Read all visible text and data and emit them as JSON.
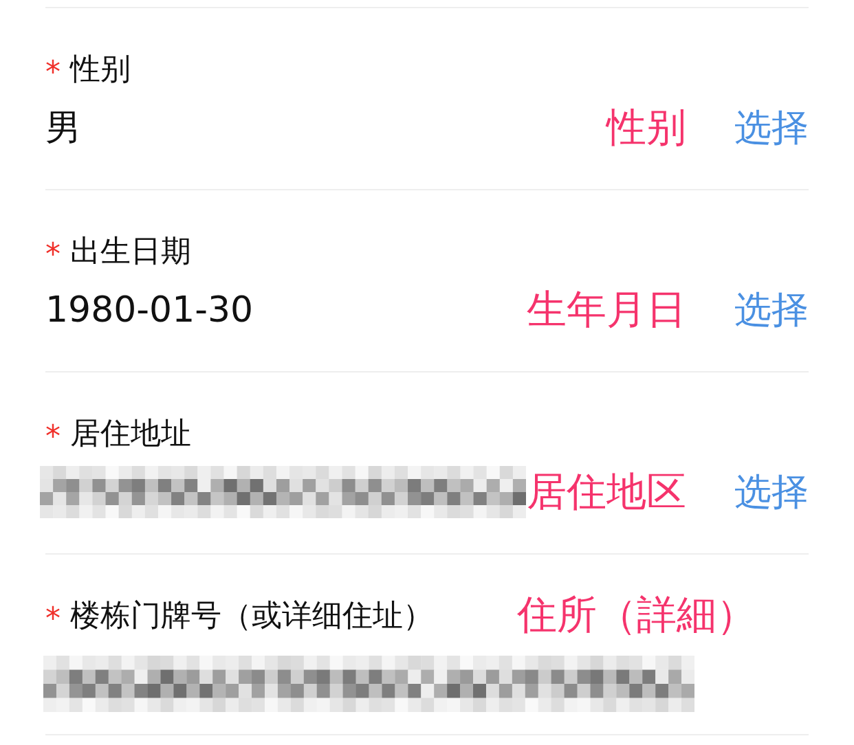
{
  "fields": [
    {
      "marker": "*",
      "label": "性别",
      "value": {
        "kind": "text",
        "text": "男"
      },
      "note": {
        "kind": "value-line",
        "text": "性别"
      },
      "action": "选择"
    },
    {
      "marker": "*",
      "label": "出生日期",
      "value": {
        "kind": "text",
        "text": "1980-01-30"
      },
      "note": {
        "kind": "value-line",
        "text": "生年月日"
      },
      "action": "选择"
    },
    {
      "marker": "*",
      "label": "居住地址",
      "value": {
        "kind": "redacted"
      },
      "note": {
        "kind": "value-line",
        "text": "居住地区"
      },
      "action": "选择"
    },
    {
      "marker": "*",
      "label": "楼栋门牌号（或详细住址）",
      "value": {
        "kind": "redacted"
      },
      "note": {
        "kind": "label-line",
        "text": "住所（詳細）"
      }
    }
  ]
}
